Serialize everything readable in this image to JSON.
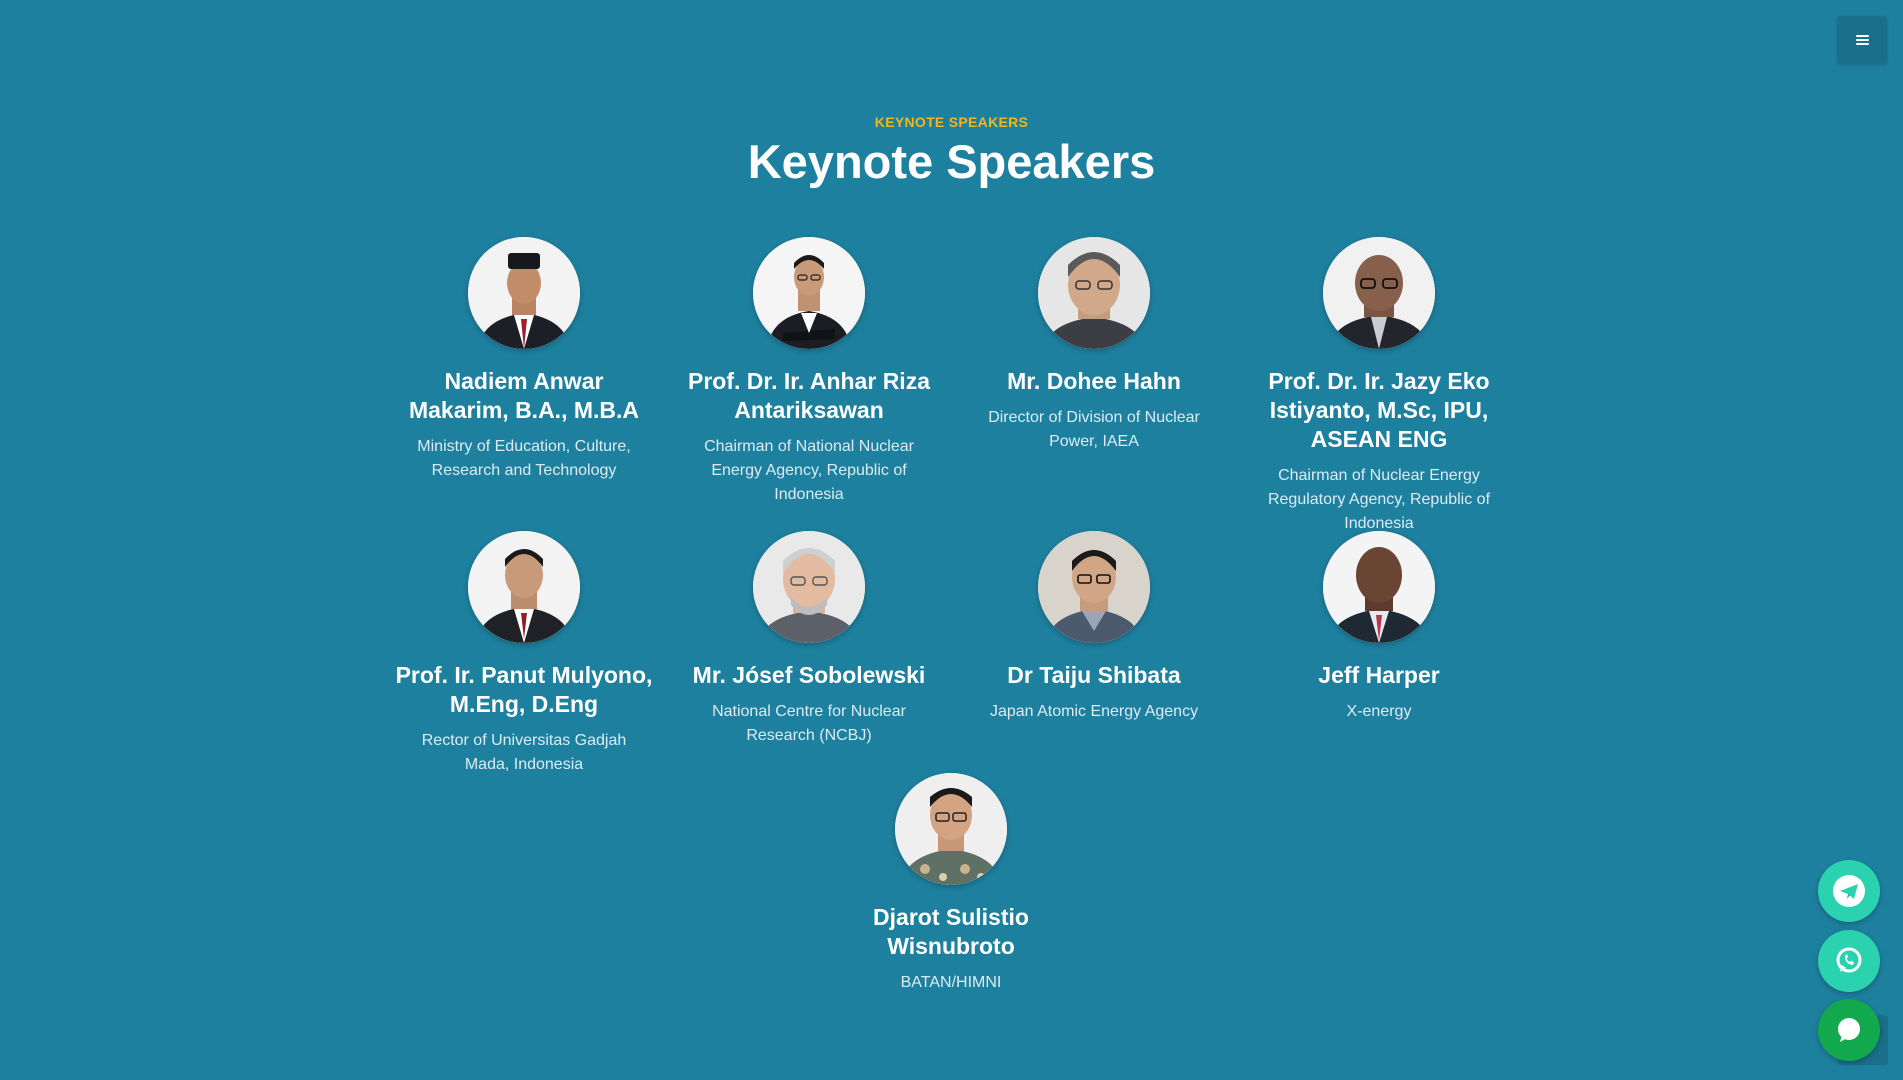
{
  "header": {
    "eyebrow": "KEYNOTE SPEAKERS",
    "title": "Keynote Speakers"
  },
  "speakers": [
    {
      "name": "Nadiem Anwar Makarim, B.A., M.B.A",
      "role": "Ministry of Education, Culture, Research and Technology"
    },
    {
      "name": "Prof. Dr. Ir. Anhar Riza Antariksawan",
      "role": "Chairman of National Nuclear Energy Agency, Republic of Indonesia"
    },
    {
      "name": "Mr. Dohee Hahn",
      "role": "Director of Division of Nuclear Power, IAEA"
    },
    {
      "name": "Prof. Dr. Ir. Jazy Eko Istiyanto, M.Sc, IPU, ASEAN ENG",
      "role": "Chairman of Nuclear Energy Regulatory Agency, Republic of Indonesia"
    },
    {
      "name": "Prof. Ir. Panut Mulyono, M.Eng, D.Eng",
      "role": "Rector of Universitas Gadjah Mada, Indonesia"
    },
    {
      "name": "Mr. Jósef Sobolewski",
      "role": "National Centre for Nuclear Research (NCBJ)"
    },
    {
      "name": "Dr Taiju Shibata",
      "role": "Japan Atomic Energy Agency"
    },
    {
      "name": "Jeff Harper",
      "role": "X-energy"
    },
    {
      "name": "Djarot Sulistio Wisnubroto",
      "role": "BATAN/HIMNI"
    }
  ],
  "icons": {
    "menu": "hamburger-icon",
    "telegram": "telegram-icon",
    "whatsapp": "whatsapp-icon",
    "chat": "chat-bubble-icon"
  },
  "colors": {
    "background": "#1e809f",
    "accent": "#f2b51c",
    "fab_green": "#2bd2b0",
    "chat_green": "#11a84e"
  }
}
